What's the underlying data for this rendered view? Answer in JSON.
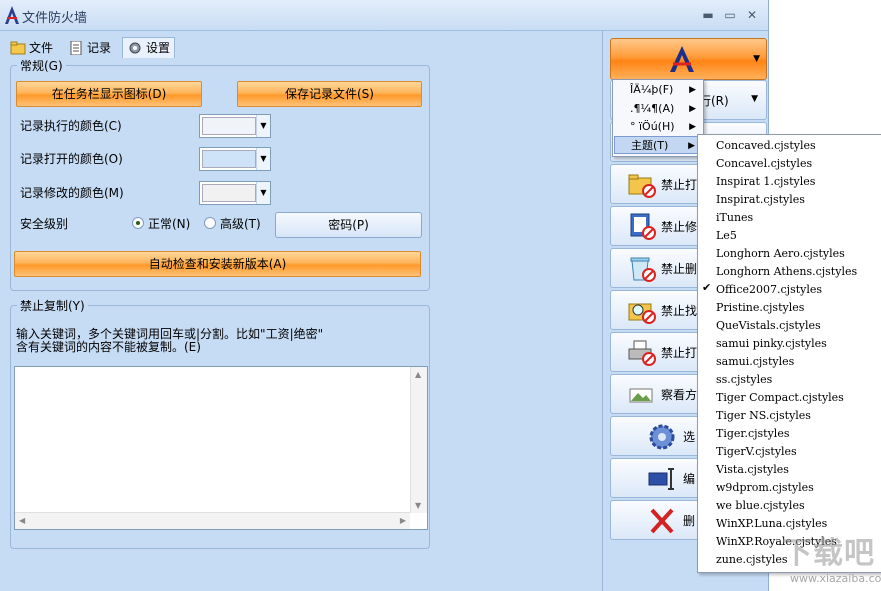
{
  "window": {
    "title": "文件防火墙"
  },
  "tabs": [
    {
      "label": "文件"
    },
    {
      "label": "记录"
    },
    {
      "label": "设置",
      "active": true
    }
  ],
  "general": {
    "title": "常规(G)",
    "taskbar_button": "在任务栏显示图标(D)",
    "save_log_button": "保存记录文件(S)",
    "color_exec_label": "记录执行的颜色(C)",
    "color_open_label": "记录打开的颜色(O)",
    "color_modify_label": "记录修改的颜色(M)",
    "color_exec_value": "#f0f4f8",
    "color_open_value": "#cfe3f8",
    "color_modify_value": "#f1f1f1",
    "security_label": "安全级别",
    "radio_normal": "正常(N)",
    "radio_high": "高级(T)",
    "selected_level": "normal",
    "password_button": "密码(P)",
    "update_button": "自动检查和安装新版本(A)"
  },
  "copy_block": {
    "title": "禁止复制(Y)",
    "desc_line1": "输入关键词，多个关键词用回车或|分割。比如\"工资|绝密\"",
    "desc_line2": "含有关键词的内容不能被复制。(E)",
    "text_value": ""
  },
  "sidebar": {
    "row1_partial": "行(R)",
    "buttons": [
      {
        "label": "禁止打",
        "icon": "folder-block-icon"
      },
      {
        "label": "禁止修",
        "icon": "doc-edit-block-icon"
      },
      {
        "label": "禁止删",
        "icon": "recycle-block-icon"
      },
      {
        "label": "禁止找",
        "icon": "search-block-icon"
      },
      {
        "label": "禁止打",
        "icon": "printer-block-icon"
      },
      {
        "label": "察看方",
        "icon": "picture-icon"
      },
      {
        "label": "选",
        "icon": "gear-icon"
      },
      {
        "label": "编",
        "icon": "edit-cursor-icon"
      },
      {
        "label": "删",
        "icon": "delete-x-icon"
      }
    ]
  },
  "menu_main": [
    {
      "label": "ÎÄ¼þ(F)"
    },
    {
      "label": ".¶¼¶(A)"
    },
    {
      "label": "° ïÖú(H)"
    },
    {
      "label": "主题(T)",
      "highlighted": true
    }
  ],
  "menu_themes": {
    "selected": "Office2007.cjstyles",
    "items": [
      "Concaved.cjstyles",
      "Concavel.cjstyles",
      "Inspirat 1.cjstyles",
      "Inspirat.cjstyles",
      "iTunes",
      "Le5",
      "Longhorn Aero.cjstyles",
      "Longhorn Athens.cjstyles",
      "Office2007.cjstyles",
      "Pristine.cjstyles",
      "QueVistals.cjstyles",
      "samui pinky.cjstyles",
      "samui.cjstyles",
      "ss.cjstyles",
      "Tiger Compact.cjstyles",
      "Tiger NS.cjstyles",
      "Tiger.cjstyles",
      "TigerV.cjstyles",
      "Vista.cjstyles",
      "w9dprom.cjstyles",
      "we blue.cjstyles",
      "WinXP.Luna.cjstyles",
      "WinXP.Royale.cjstyles",
      "zune.cjstyles"
    ]
  },
  "watermark": {
    "brand": "下载吧",
    "url": "www.xiazaiba.com"
  }
}
